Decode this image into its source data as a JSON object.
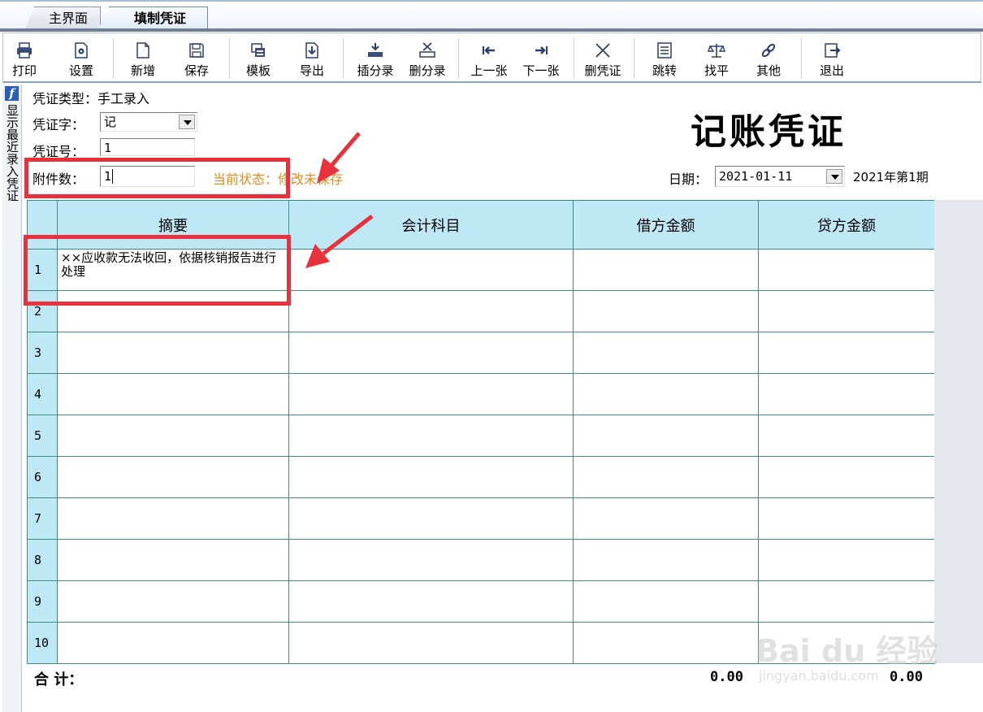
{
  "tabs": [
    {
      "label": "主界面"
    },
    {
      "label": "填制凭证"
    }
  ],
  "toolbar": {
    "print": "打印",
    "settings": "设置",
    "new": "新增",
    "save": "保存",
    "template": "模板",
    "export": "导出",
    "insert_entry": "插分录",
    "delete_entry": "删分录",
    "prev": "上一张",
    "next": "下一张",
    "delete_voucher": "删凭证",
    "jump": "跳转",
    "balance": "找平",
    "other": "其他",
    "exit": "退出"
  },
  "sidebar": {
    "label": "显示最近录入凭证"
  },
  "header": {
    "voucher_type_label": "凭证类型：",
    "voucher_type_value": "手工录入",
    "voucher_word_label": "凭证字：",
    "voucher_word_value": "记",
    "voucher_no_label": "凭证号：",
    "voucher_no_value": "1",
    "attachments_label": "附件数：",
    "attachments_value": "1",
    "status_label": "当前状态：",
    "status_value": "修改未保存",
    "title": "记账凭证",
    "date_label": "日期：",
    "date_value": "2021-01-11",
    "period": "2021年第1期"
  },
  "grid": {
    "columns": [
      "摘要",
      "会计科目",
      "借方金额",
      "贷方金额"
    ],
    "rows": [
      {
        "no": "1",
        "summary": "××应收款无法收回，依据核销报告进行处理",
        "account": "",
        "debit": "",
        "credit": ""
      },
      {
        "no": "2",
        "summary": "",
        "account": "",
        "debit": "",
        "credit": ""
      },
      {
        "no": "3",
        "summary": "",
        "account": "",
        "debit": "",
        "credit": ""
      },
      {
        "no": "4",
        "summary": "",
        "account": "",
        "debit": "",
        "credit": ""
      },
      {
        "no": "5",
        "summary": "",
        "account": "",
        "debit": "",
        "credit": ""
      },
      {
        "no": "6",
        "summary": "",
        "account": "",
        "debit": "",
        "credit": ""
      },
      {
        "no": "7",
        "summary": "",
        "account": "",
        "debit": "",
        "credit": ""
      },
      {
        "no": "8",
        "summary": "",
        "account": "",
        "debit": "",
        "credit": ""
      },
      {
        "no": "9",
        "summary": "",
        "account": "",
        "debit": "",
        "credit": ""
      },
      {
        "no": "10",
        "summary": "",
        "account": "",
        "debit": "",
        "credit": ""
      }
    ]
  },
  "totals": {
    "label": "合 计：",
    "debit": "0.00",
    "credit": "0.00"
  },
  "watermark": {
    "text": "Bai du 经验",
    "sub": "jingyan.baidu.com"
  },
  "colors": {
    "highlight": "#e8313b",
    "status": "#e08b1a",
    "grid_header": "#bfe8f6",
    "grid_line": "#3e8a87"
  }
}
